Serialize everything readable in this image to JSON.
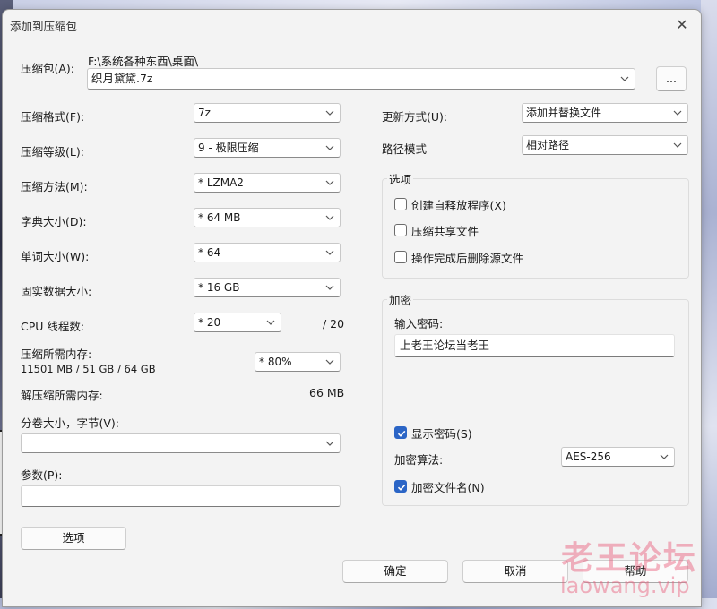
{
  "window": {
    "title": "添加到压缩包",
    "close_glyph": "✕"
  },
  "archive": {
    "label": "压缩包(A):",
    "path": "F:\\系统各种东西\\桌面\\",
    "filename": "织月黛黛.7z",
    "browse_label": "..."
  },
  "left": {
    "format": {
      "label": "压缩格式(F):",
      "value": "7z"
    },
    "level": {
      "label": "压缩等级(L):",
      "value": "9 - 极限压缩"
    },
    "method": {
      "label": "压缩方法(M):",
      "value": "* LZMA2"
    },
    "dict": {
      "label": "字典大小(D):",
      "value": "* 64 MB"
    },
    "word": {
      "label": "单词大小(W):",
      "value": "* 64"
    },
    "solid": {
      "label": "固实数据大小:",
      "value": "* 16 GB"
    },
    "cpu": {
      "label": "CPU 线程数:",
      "value": "* 20",
      "max": "/ 20"
    },
    "memory": {
      "label": "压缩所需内存:",
      "detail": "11501 MB / 51 GB / 64 GB",
      "value": "* 80%"
    },
    "decomp": {
      "label": "解压缩所需内存:",
      "value": "66 MB"
    },
    "volume": {
      "label": "分卷大小，字节(V):",
      "value": ""
    },
    "params": {
      "label": "参数(P):",
      "value": ""
    },
    "options_button": "选项"
  },
  "right": {
    "update": {
      "label": "更新方式(U):",
      "value": "添加并替换文件"
    },
    "path_mode": {
      "label": "路径模式",
      "value": "相对路径"
    },
    "options_group": {
      "title": "选项",
      "items": [
        {
          "label": "创建自释放程序(X)",
          "checked": false
        },
        {
          "label": "压缩共享文件",
          "checked": false
        },
        {
          "label": "操作完成后删除源文件",
          "checked": false
        }
      ]
    },
    "encryption": {
      "title": "加密",
      "password_label": "输入密码:",
      "password": "上老王论坛当老王",
      "show_password": {
        "label": "显示密码(S)",
        "checked": true
      },
      "algorithm": {
        "label": "加密算法:",
        "value": "AES-256"
      },
      "encrypt_names": {
        "label": "加密文件名(N)",
        "checked": true
      }
    }
  },
  "buttons": {
    "ok": "确定",
    "cancel": "取消",
    "help": "帮助"
  },
  "watermark": {
    "line1": "老王论坛",
    "line2": "laowang.vip"
  },
  "colors": {
    "accent": "#2b65c6",
    "dialog_bg": "#f3f3f3"
  }
}
